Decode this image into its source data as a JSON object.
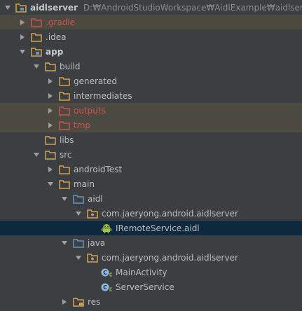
{
  "project": {
    "name": "aidlserver",
    "path": "D:₩AndroidStudioWorkspace₩AidlExample₩aidlserver"
  },
  "tree": {
    "gradle": ".gradle",
    "idea": ".idea",
    "app": "app",
    "build": "build",
    "generated": "generated",
    "intermediates": "intermediates",
    "outputs": "outputs",
    "tmp": "tmp",
    "libs": "libs",
    "src": "src",
    "androidTest": "androidTest",
    "main": "main",
    "aidl": "aidl",
    "aidl_pkg": "com.jaeryong.android.aidlserver",
    "aidl_file": "IRemoteService.aidl",
    "java": "java",
    "java_pkg": "com.jaeryong.android.aidlserver",
    "main_activity": "MainActivity",
    "server_service": "ServerService",
    "res": "res"
  },
  "colors": {
    "background": "#3c3f41",
    "highlight_row": "#4c4a40",
    "selected_row": "#0d293e",
    "folder_orange": "#d6a24d",
    "folder_blue": "#6897bb",
    "excluded_red": "#d25252",
    "android_green": "#a4c639",
    "class_blue": "#89bde8"
  }
}
